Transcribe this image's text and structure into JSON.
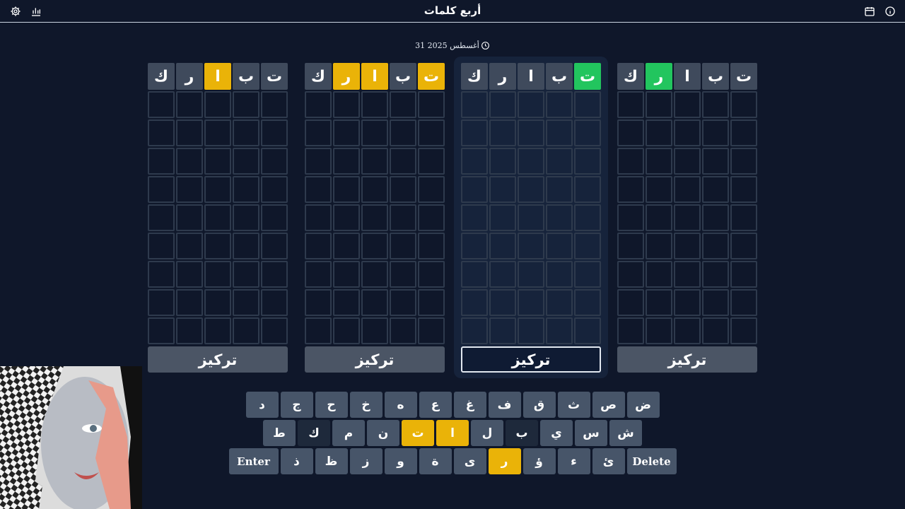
{
  "header": {
    "title": "أربع كلمات",
    "icons": [
      "settings-gear-icon",
      "stats-bar-chart-icon",
      "calendar-icon",
      "info-circle-icon"
    ]
  },
  "date": {
    "text": "31 أغسطس 2025",
    "icon": "clock-icon"
  },
  "colors": {
    "green": "#22c55e",
    "yellow": "#eab308",
    "gray": "#3f4a5c",
    "background": "#0f172a"
  },
  "boards": [
    {
      "guess": [
        {
          "l": "ت",
          "s": "gray"
        },
        {
          "l": "ب",
          "s": "gray"
        },
        {
          "l": "ا",
          "s": "gray"
        },
        {
          "l": "ر",
          "s": "green"
        },
        {
          "l": "ك",
          "s": "gray"
        }
      ],
      "focus_label": "تركيز",
      "active": false
    },
    {
      "guess": [
        {
          "l": "ت",
          "s": "green"
        },
        {
          "l": "ب",
          "s": "gray"
        },
        {
          "l": "ا",
          "s": "gray"
        },
        {
          "l": "ر",
          "s": "gray"
        },
        {
          "l": "ك",
          "s": "gray"
        }
      ],
      "focus_label": "تركيز",
      "active": false
    },
    {
      "guess": [
        {
          "l": "ت",
          "s": "yellow"
        },
        {
          "l": "ب",
          "s": "gray"
        },
        {
          "l": "ا",
          "s": "yellow"
        },
        {
          "l": "ر",
          "s": "yellow"
        },
        {
          "l": "ك",
          "s": "gray"
        }
      ],
      "focus_label": "تركيز",
      "active": true
    },
    {
      "guess": [
        {
          "l": "ت",
          "s": "gray"
        },
        {
          "l": "ب",
          "s": "gray"
        },
        {
          "l": "ا",
          "s": "yellow"
        },
        {
          "l": "ر",
          "s": "gray"
        },
        {
          "l": "ك",
          "s": "gray"
        }
      ],
      "focus_label": "تركيز",
      "active": false
    }
  ],
  "empty_rows": 9,
  "keyboard": {
    "rows": [
      [
        {
          "k": "د"
        },
        {
          "k": "ج"
        },
        {
          "k": "ح"
        },
        {
          "k": "خ"
        },
        {
          "k": "ه"
        },
        {
          "k": "ع"
        },
        {
          "k": "غ"
        },
        {
          "k": "ف"
        },
        {
          "k": "ق"
        },
        {
          "k": "ث"
        },
        {
          "k": "ص"
        },
        {
          "k": "ض"
        }
      ],
      [
        {
          "k": "ط"
        },
        {
          "k": "ك",
          "s": "dark"
        },
        {
          "k": "م"
        },
        {
          "k": "ن"
        },
        {
          "k": "ت",
          "s": "yellow"
        },
        {
          "k": "ا",
          "s": "yellow"
        },
        {
          "k": "ل"
        },
        {
          "k": "ب",
          "s": "dark"
        },
        {
          "k": "ي"
        },
        {
          "k": "س"
        },
        {
          "k": "ش"
        }
      ],
      [
        {
          "k": "Enter",
          "w": true
        },
        {
          "k": "ذ"
        },
        {
          "k": "ظ"
        },
        {
          "k": "ز"
        },
        {
          "k": "و"
        },
        {
          "k": "ة"
        },
        {
          "k": "ى"
        },
        {
          "k": "ر",
          "s": "yellow"
        },
        {
          "k": "ؤ"
        },
        {
          "k": "ء"
        },
        {
          "k": "ئ"
        },
        {
          "k": "Delete",
          "w": true
        }
      ]
    ]
  }
}
